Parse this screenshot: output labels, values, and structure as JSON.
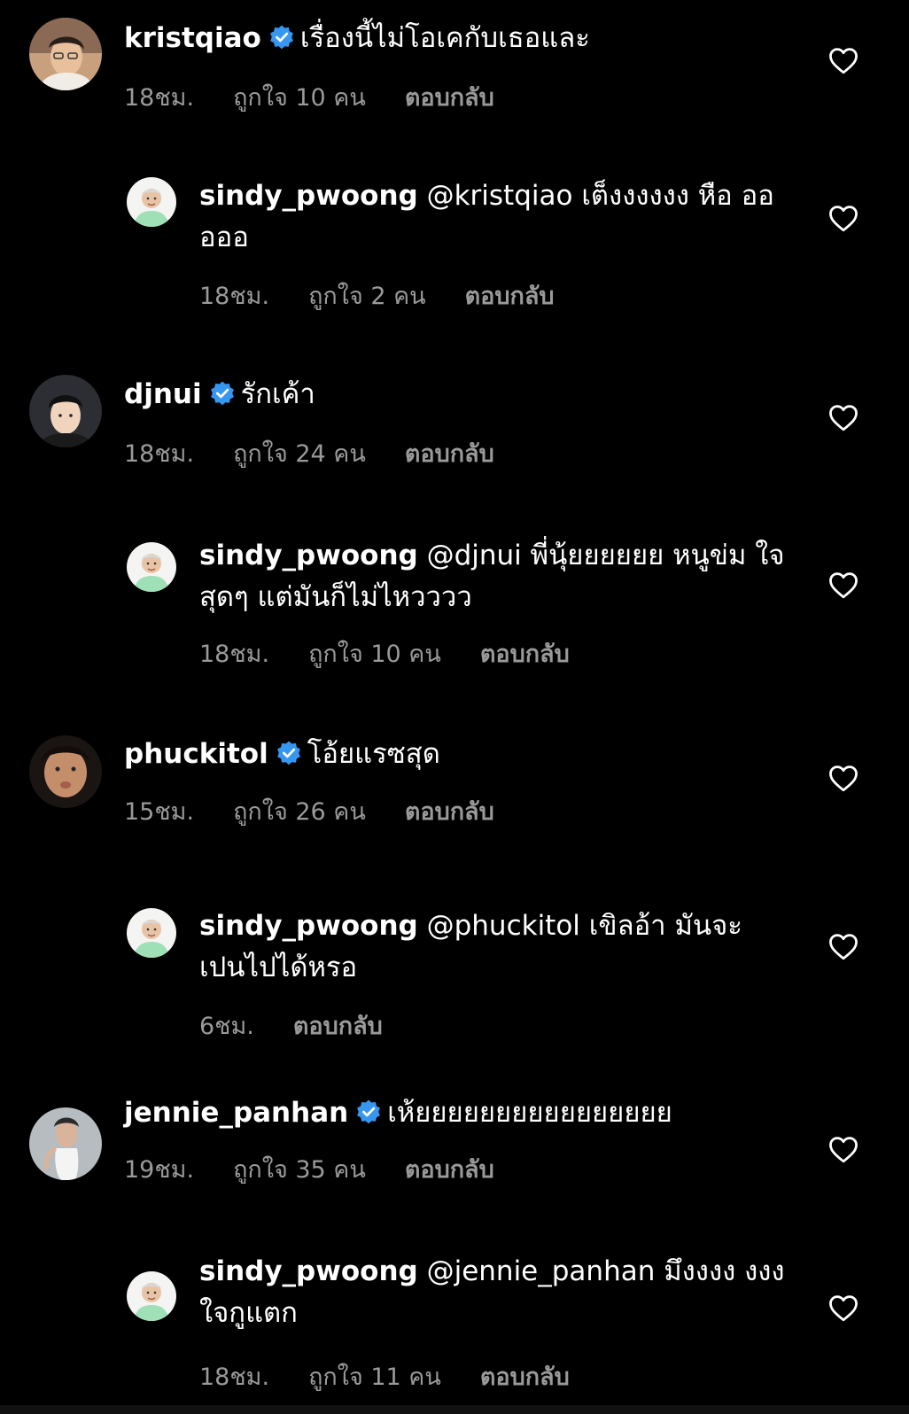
{
  "colors": {
    "background": "#000000",
    "text": "#ffffff",
    "meta": "#9a9a9a",
    "verified": "#3797f0"
  },
  "comments": [
    {
      "username": "kristqiao",
      "verified": true,
      "text": "เรื่องนี้ไม่โอเคกับเธอและ",
      "time": "18ชม.",
      "likes": "ถูกใจ 10 คน",
      "reply_label": "ตอบกลับ",
      "reply": {
        "username": "sindy_pwoong",
        "mention": "@kristqiao",
        "text": "เต็งงงงงง หือ อออออ",
        "time": "18ชม.",
        "likes": "ถูกใจ 2 คน",
        "reply_label": "ตอบกลับ"
      }
    },
    {
      "username": "djnui",
      "verified": true,
      "text": "รักเค้า",
      "time": "18ชม.",
      "likes": "ถูกใจ 24 คน",
      "reply_label": "ตอบกลับ",
      "reply": {
        "username": "sindy_pwoong",
        "mention": "@djnui",
        "text": "พี่นุ้ยยยยยย หนูข่ม ใจสุดๆ แต่มันก็ไม่ไหวววว",
        "time": "18ชม.",
        "likes": "ถูกใจ 10 คน",
        "reply_label": "ตอบกลับ"
      }
    },
    {
      "username": "phuckitol",
      "verified": true,
      "text": "โอ้ยแรซสุด",
      "time": "15ชม.",
      "likes": "ถูกใจ 26 คน",
      "reply_label": "ตอบกลับ",
      "reply": {
        "username": "sindy_pwoong",
        "mention": "@phuckitol",
        "text": "เขิลอ้า มันจะ เปนไปได้หรอ",
        "time": "6ชม.",
        "likes": "",
        "reply_label": "ตอบกลับ"
      }
    },
    {
      "username": "jennie_panhan",
      "verified": true,
      "text": "เห้ยยยยยยยยยยยยยยยย",
      "time": "19ชม.",
      "likes": "ถูกใจ 35 คน",
      "reply_label": "ตอบกลับ",
      "reply": {
        "username": "sindy_pwoong",
        "mention": "@jennie_panhan",
        "text": "มึงงงง งงง ใจกูแตก",
        "time": "18ชม.",
        "likes": "ถูกใจ 11 คน",
        "reply_label": "ตอบกลับ"
      }
    }
  ]
}
